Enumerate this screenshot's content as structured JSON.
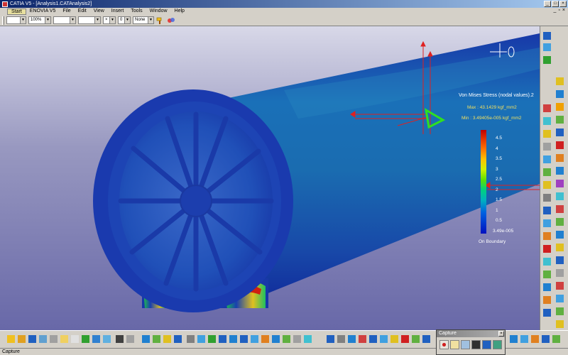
{
  "window": {
    "title": "CATIA V5 - [Analysis1.CATAnalysis2]"
  },
  "menu": {
    "items": [
      "Start",
      "ENOVIA V5",
      "File",
      "Edit",
      "View",
      "Insert",
      "Tools",
      "Window",
      "Help"
    ]
  },
  "toolbar": {
    "zoom_value": "100%",
    "number_value": "0",
    "none_value": "None"
  },
  "legend": {
    "title": "Von Mises Stress (nodal values).2",
    "max": "Max : 43.1429 kgf_mm2",
    "min": "Min : 3.49405e-005 kgf_mm2",
    "ticks": [
      "4.5",
      "4",
      "3.5",
      "3",
      "2.5",
      "2",
      "1.5",
      "1",
      "0.5",
      "3.49e-005"
    ],
    "footer": "On Boundary"
  },
  "capture": {
    "title": "Capture"
  },
  "status": {
    "text": "Capture"
  }
}
